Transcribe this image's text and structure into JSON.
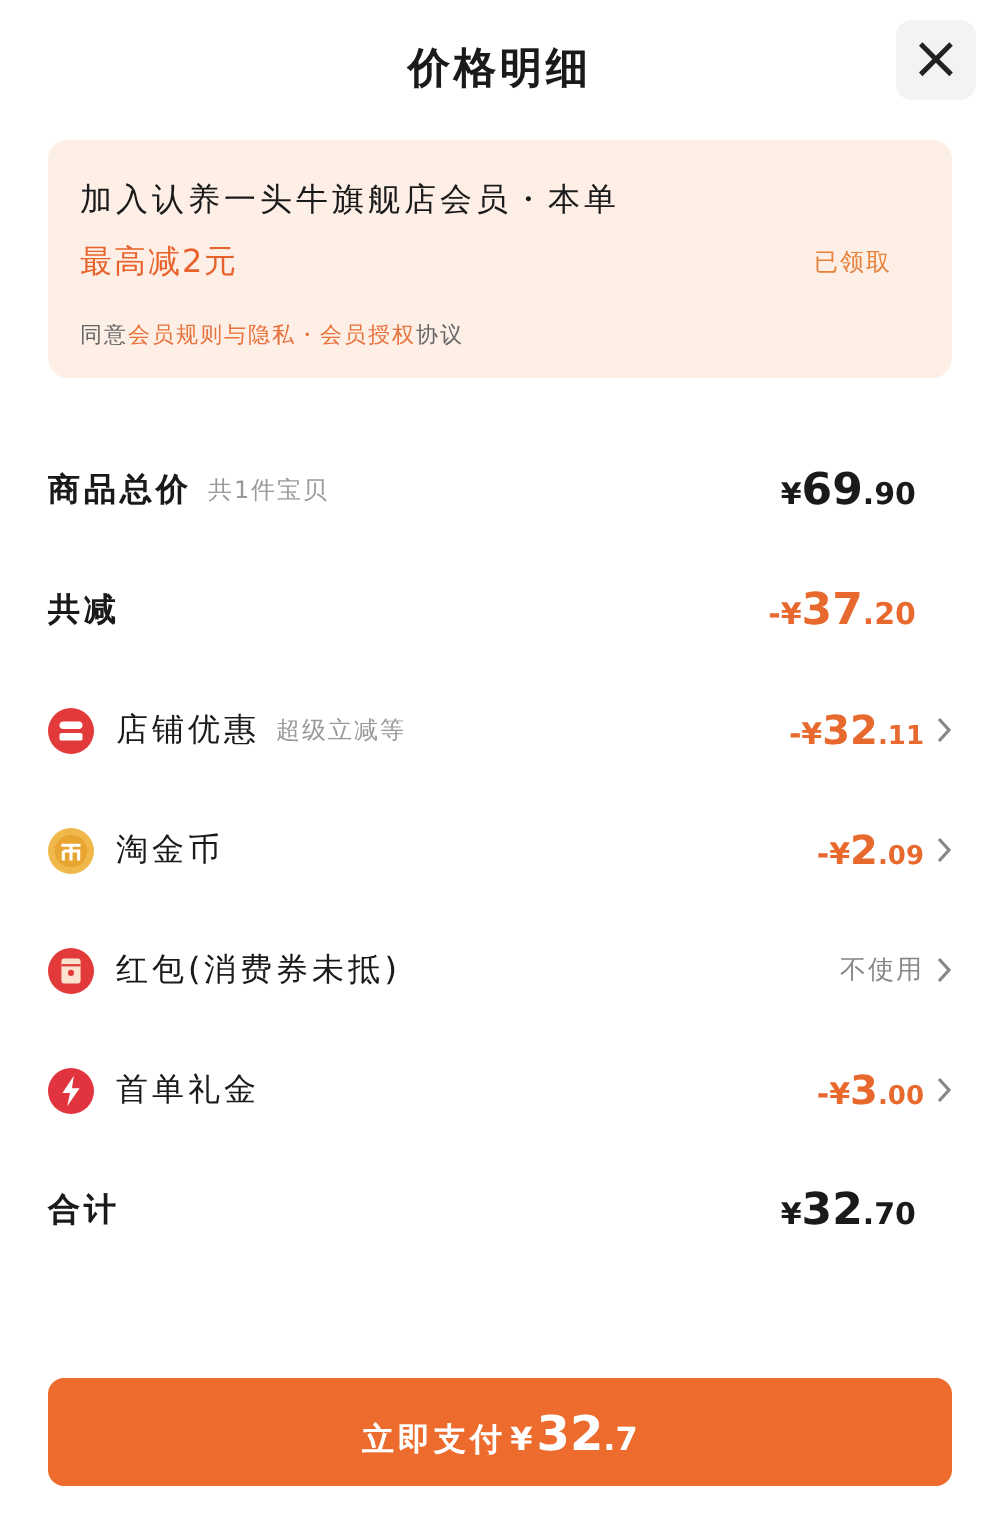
{
  "sheet": {
    "title": "价格明细",
    "close": "×"
  },
  "member_card": {
    "title": "加入认养一头牛旗舰店会员・本单",
    "offer": "最高减2元",
    "status": "已领取",
    "agreement": [
      {
        "text": "同意",
        "link": false
      },
      {
        "text": "会员规则与隐私・会员授权",
        "link": true
      },
      {
        "text": "协议",
        "link": false
      }
    ]
  },
  "rows": [
    {
      "kind": "summary",
      "label": "商品总价",
      "note": "共1件宝贝",
      "discount": false,
      "amount": {
        "prefix": "¥",
        "whole": "69",
        "fraction": ".90"
      }
    },
    {
      "kind": "summary",
      "label": "共减",
      "discount": true,
      "amount": {
        "prefix": "-¥",
        "whole": "37",
        "fraction": ".20"
      }
    },
    {
      "kind": "item",
      "label": "店铺优惠",
      "note": "超级立减等",
      "discount": true,
      "amount": {
        "prefix": "-¥",
        "whole": "32",
        "fraction": ".11"
      }
    },
    {
      "kind": "item",
      "label": "淘金币",
      "discount": true,
      "amount": {
        "prefix": "-¥",
        "whole": "2",
        "fraction": ".09"
      }
    },
    {
      "kind": "item",
      "label": "红包(消费券未抵)",
      "value": "不使用"
    },
    {
      "kind": "item",
      "label": "首单礼金",
      "discount": true,
      "amount": {
        "prefix": "-¥",
        "whole": "3",
        "fraction": ".00"
      }
    },
    {
      "kind": "summary",
      "label": "合计",
      "discount": false,
      "amount": {
        "prefix": "¥",
        "whole": "32",
        "fraction": ".70"
      }
    }
  ],
  "pay_button": {
    "label": "立即支付",
    "amount": {
      "prefix": "¥",
      "whole": "32",
      "fraction": ".7"
    }
  }
}
